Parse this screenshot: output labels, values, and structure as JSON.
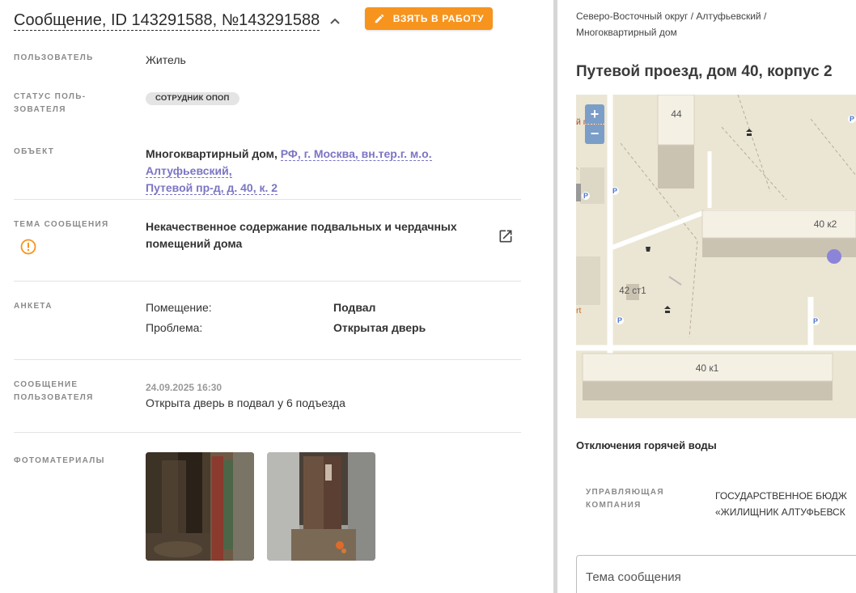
{
  "header": {
    "title": "Сообщение, ID 143291588, №143291588",
    "take_button": "ВЗЯТЬ В РАБОТУ",
    "accent_color": "#f7941d"
  },
  "fields": {
    "user": {
      "label": "ПОЛЬЗОВАТЕЛЬ",
      "value": "Житель"
    },
    "user_status": {
      "label_line1": "СТАТУС ПОЛЬ-",
      "label_line2": "ЗОВАТЕЛЯ",
      "badge": "СОТРУДНИК ОПОП"
    },
    "object": {
      "label": "ОБЪЕКТ",
      "type": "Многоквартирный дом,",
      "address_line1": "РФ, г. Москва, вн.тер.г. м.о. Алтуфьевский,",
      "address_line2": "Путевой пр-д, д. 40, к. 2",
      "link_color": "#7b75c4"
    },
    "topic": {
      "label": "ТЕМА СООБЩЕНИЯ",
      "line1": "Некачественное содержание подвальных и чердачных",
      "line2": "помещений дома",
      "warn_icon": "warning-circle-icon",
      "open_icon": "open-in-new-icon"
    },
    "questionnaire": {
      "label": "АНКЕТА",
      "rows": [
        {
          "key": "Помещение:",
          "value": "Подвал"
        },
        {
          "key": "Проблема:",
          "value": "Открытая дверь"
        }
      ]
    },
    "user_message": {
      "label_line1": "СООБЩЕНИЕ",
      "label_line2": "ПОЛЬЗОВАТЕЛЯ",
      "date": "24.09.2025 16:30",
      "text": "Открыта дверь в подвал у 6 подъезда"
    },
    "photos": {
      "label": "ФОТОМАТЕРИАЛЫ"
    }
  },
  "right": {
    "breadcrumb_line1": "Северо-Восточный округ / Алтуфьевский /",
    "breadcrumb_line2": "Многоквартирный дом",
    "address": "Путевой проезд, дом 40, корпус 2",
    "map": {
      "zoom_in": "+",
      "zoom_out": "−",
      "buildings": {
        "b44": "44",
        "b40k2": "40 к2",
        "b42": "42 ст1",
        "b40k1": "40 к1"
      },
      "poi_text": "й пункт",
      "poi_text2": "rt",
      "parking": "P",
      "marker_color": "#8c84d8"
    },
    "hot_water": "Отключения горячей воды",
    "management": {
      "label_line1": "УПРАВЛЯЮЩАЯ",
      "label_line2": "КОМПАНИЯ",
      "value_line1": "ГОСУДАРСТВЕННОЕ БЮДЖ",
      "value_line2": "«ЖИЛИЩНИК АЛТУФЬЕВСК"
    },
    "topic_input_placeholder": "Тема сообщения"
  }
}
